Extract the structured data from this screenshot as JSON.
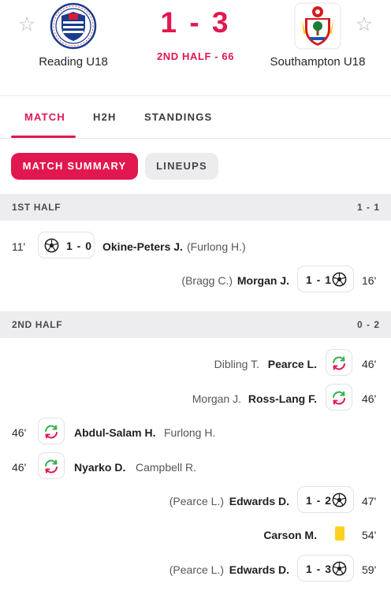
{
  "match": {
    "home_team": "Reading U18",
    "away_team": "Southampton U18",
    "score": "1 - 3",
    "status": "2ND HALF - 66"
  },
  "tabs": [
    {
      "label": "MATCH",
      "active": true
    },
    {
      "label": "H2H",
      "active": false
    },
    {
      "label": "STANDINGS",
      "active": false
    }
  ],
  "pills": {
    "summary": "MATCH SUMMARY",
    "lineups": "LINEUPS"
  },
  "first_half": {
    "label": "1ST HALF",
    "score": "1 - 1",
    "events": [
      {
        "side": "home",
        "type": "goal",
        "minute": "11'",
        "score": "1 - 0",
        "player": "Okine-Peters J.",
        "assist": "(Furlong H.)"
      },
      {
        "side": "away",
        "type": "goal",
        "minute": "16'",
        "score": "1 - 1",
        "player": "Morgan J.",
        "assist": "(Bragg C.)"
      }
    ]
  },
  "second_half": {
    "label": "2ND HALF",
    "score": "0 - 2",
    "events": [
      {
        "side": "away",
        "type": "sub",
        "minute": "46'",
        "player": "Pearce L.",
        "assist": "Dibling T."
      },
      {
        "side": "away",
        "type": "sub",
        "minute": "46'",
        "player": "Ross-Lang F.",
        "assist": "Morgan J."
      },
      {
        "side": "home",
        "type": "sub",
        "minute": "46'",
        "player": "Abdul-Salam H.",
        "assist": "Furlong H."
      },
      {
        "side": "home",
        "type": "sub",
        "minute": "46'",
        "player": "Nyarko D.",
        "assist": "Campbell R."
      },
      {
        "side": "away",
        "type": "goal",
        "minute": "47'",
        "score": "1 - 2",
        "player": "Edwards D.",
        "assist": "(Pearce L.)"
      },
      {
        "side": "away",
        "type": "card",
        "minute": "54'",
        "player": "Carson M.",
        "assist": ""
      },
      {
        "side": "away",
        "type": "goal",
        "minute": "59'",
        "score": "1 - 3",
        "player": "Edwards D.",
        "assist": "(Pearce L.)"
      }
    ]
  },
  "colors": {
    "accent": "#e1184f",
    "sub_green": "#2fb24c",
    "sub_red": "#e1184f",
    "yellow_card": "#fdd01e",
    "period_bg": "#ededf0"
  }
}
